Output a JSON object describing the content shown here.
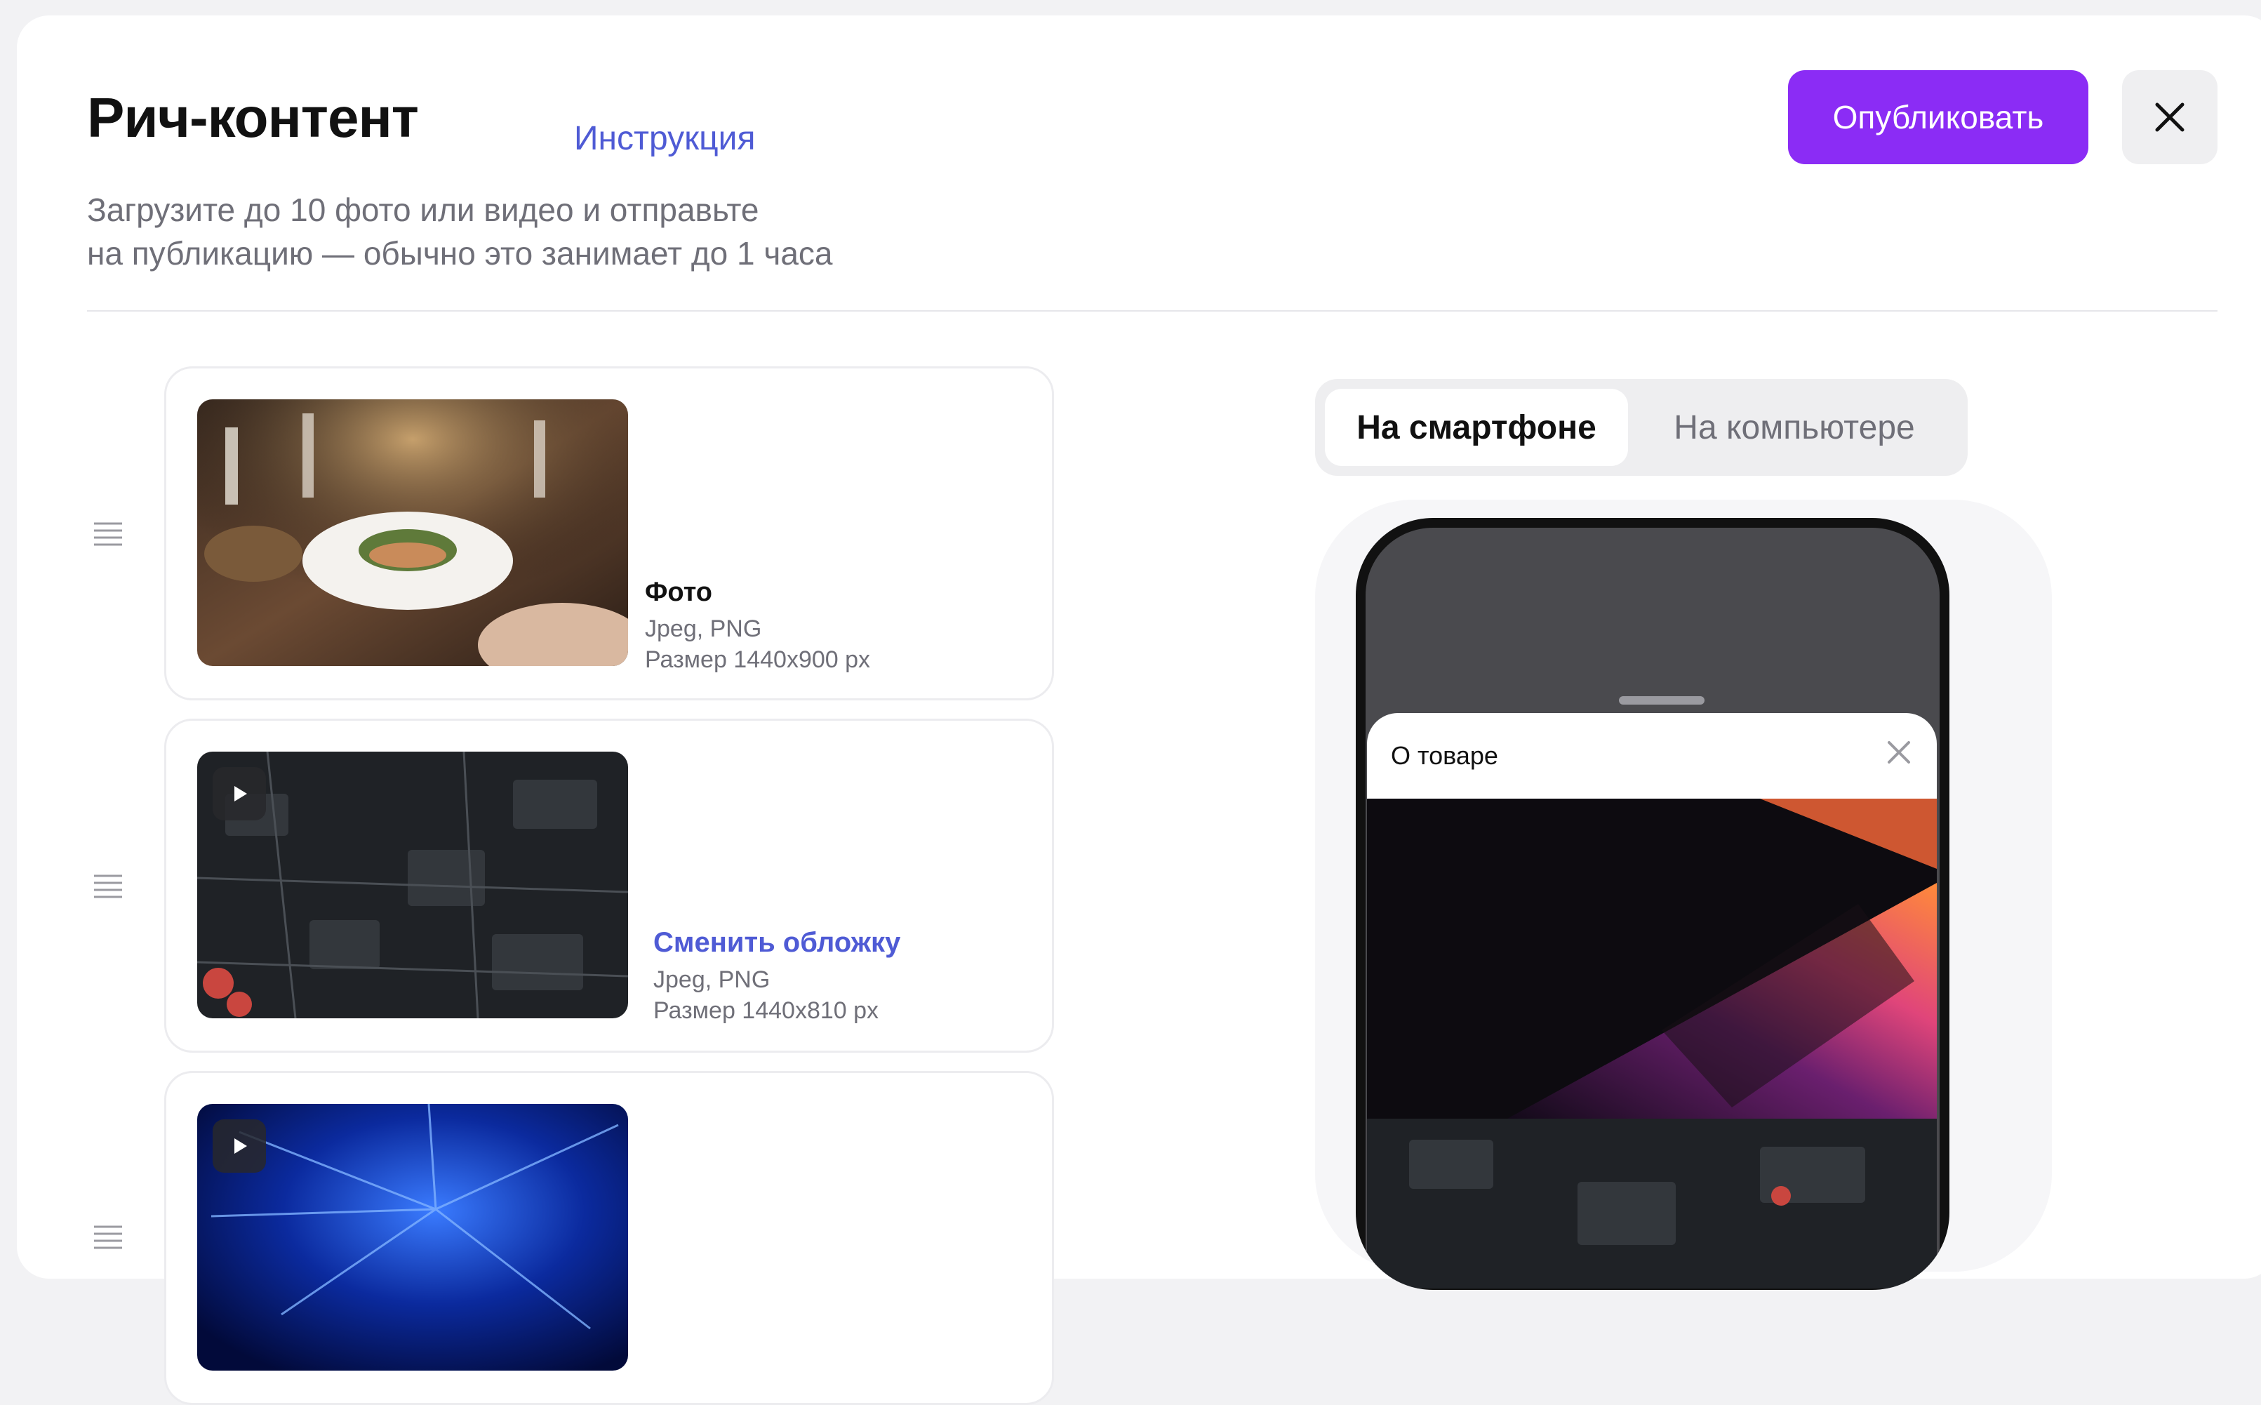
{
  "header": {
    "title": "Рич-контент",
    "instruction_link": "Инструкция",
    "subtitle_line1": "Загрузите до 10 фото или видео и отправьте",
    "subtitle_line2": "на публикацию — обычно это занимает до 1 часа",
    "publish_label": "Опубликовать"
  },
  "items": [
    {
      "title": "Фото",
      "formats": "Jpeg, PNG",
      "size": "Размер 1440x900 px"
    },
    {
      "cover_link": "Сменить обложку",
      "formats": "Jpeg, PNG",
      "size": "Размер 1440x810 px"
    },
    {
      "cover_link": "",
      "formats": "",
      "size": ""
    }
  ],
  "preview": {
    "tabs": [
      "На смартфоне",
      "На компьютере"
    ],
    "active_tab": "На смартфоне",
    "sheet_title": "О товаре"
  },
  "colors": {
    "accent": "#8b2cf5",
    "link": "#4f5bd5"
  },
  "icons": {
    "close": "close-icon",
    "drag": "drag-handle-icon",
    "play": "play-icon"
  }
}
